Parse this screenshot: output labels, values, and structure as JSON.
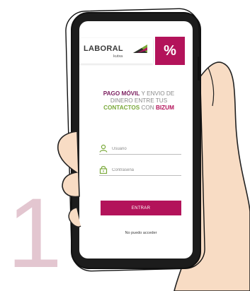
{
  "step_number": "1",
  "brand": {
    "name": "LABORAL",
    "sub": "kutxa",
    "badge_symbol": "%",
    "color": "#b3135a",
    "flag_green": "#7aa93a"
  },
  "headline": {
    "part1": "PAGO MÓVIL",
    "part2": " Y ENVIO DE DINERO ENTRE TUS ",
    "part3": "CONTACTOS",
    "part4": " CON ",
    "part5": "BIZUM"
  },
  "login": {
    "user_placeholder": "Usuario",
    "password_placeholder": "Contraseña",
    "enter_label": "ENTRAR",
    "forgot_link": "No puedo acceder"
  },
  "colors": {
    "accent": "#b3135a",
    "green": "#7aa93a",
    "skin": "#f8dcc4",
    "outline": "#222222",
    "number": "#e3c6d0"
  },
  "icons": {
    "user": "user-icon",
    "lock": "lock-icon"
  }
}
